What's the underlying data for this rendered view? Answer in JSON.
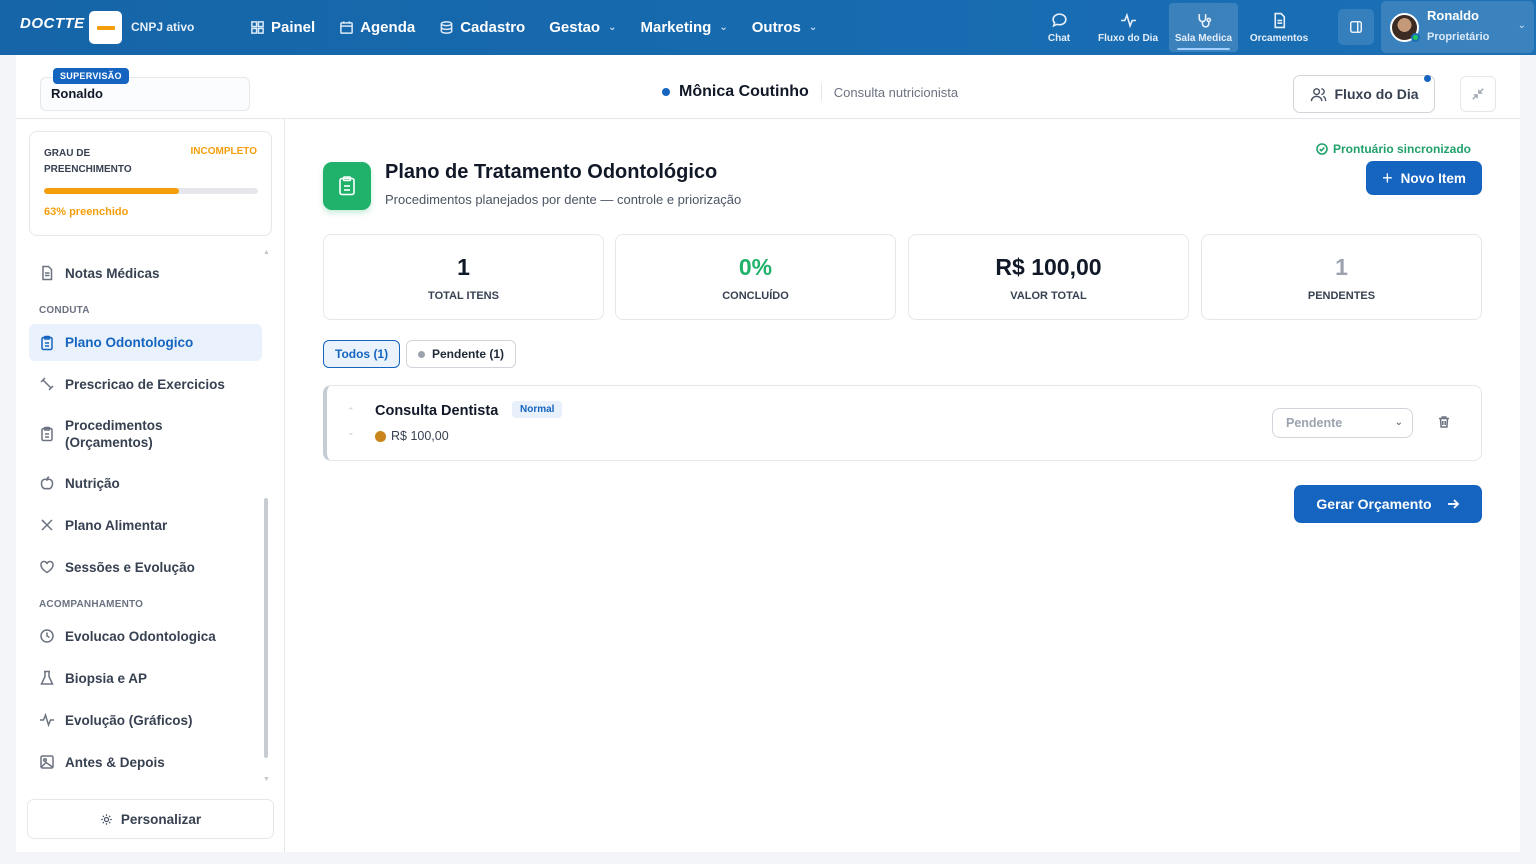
{
  "topbar": {
    "logo": "DOCTTE",
    "cnpj_status": "CNPJ ativo",
    "nav": [
      {
        "label": "Painel"
      },
      {
        "label": "Agenda"
      },
      {
        "label": "Cadastro"
      },
      {
        "label": "Gestao"
      },
      {
        "label": "Marketing"
      },
      {
        "label": "Outros"
      }
    ],
    "quick": [
      {
        "label": "Chat",
        "icon": "chat-icon"
      },
      {
        "label": "Fluxo do Dia",
        "icon": "activity-icon"
      },
      {
        "label": "Sala Medica",
        "icon": "stethoscope-icon"
      },
      {
        "label": "Orcamentos",
        "icon": "document-icon"
      }
    ],
    "user": {
      "name": "Ronaldo",
      "role": "Proprietário"
    }
  },
  "subheader": {
    "supervision_tag": "SUPERVISÃO",
    "supervision_name": "Ronaldo",
    "patient_name": "Mônica Coutinho",
    "consultation": "Consulta nutricionista",
    "fluxo_button": "Fluxo do Dia"
  },
  "sidebar": {
    "progress": {
      "label": "GRAU DE PREENCHIMENTO",
      "status": "INCOMPLETO",
      "percent": 63,
      "text": "63% preenchido"
    },
    "items": [
      {
        "label": "Notas Médicas"
      },
      {
        "label": "Plano Odontologico"
      },
      {
        "label": "Prescricao de Exercicios"
      },
      {
        "label": "Procedimentos (Orçamentos)"
      },
      {
        "label": "Nutrição"
      },
      {
        "label": "Plano Alimentar"
      },
      {
        "label": "Sessões e Evolução"
      },
      {
        "label": "Evolucao Odontologica"
      },
      {
        "label": "Biopsia e AP"
      },
      {
        "label": "Evolução (Gráficos)"
      },
      {
        "label": "Antes & Depois"
      }
    ],
    "sections": {
      "conduta": "CONDUTA",
      "acompanhamento": "ACOMPANHAMENTO"
    },
    "personalizar": "Personalizar"
  },
  "main": {
    "sync_status": "Prontuário sincronizado",
    "title": "Plano de Tratamento Odontológico",
    "subtitle": "Procedimentos planejados por dente — controle e priorização",
    "new_button": "Novo Item",
    "stats": [
      {
        "value": "1",
        "label": "TOTAL ITENS",
        "color": "#111827"
      },
      {
        "value": "0%",
        "label": "CONCLUÍDO",
        "color": "#20b26b"
      },
      {
        "value": "R$ 100,00",
        "label": "VALOR TOTAL",
        "color": "#111827"
      },
      {
        "value": "1",
        "label": "PENDENTES",
        "color": "#9ca3af"
      }
    ],
    "filters": [
      {
        "label": "Todos (1)"
      },
      {
        "label": "Pendente (1)"
      }
    ],
    "items": [
      {
        "name": "Consulta Dentista",
        "priority": "Normal",
        "price": "R$ 100,00",
        "status": "Pendente"
      }
    ],
    "generate_button": "Gerar Orçamento"
  },
  "colors": {
    "primary": "#1565c0",
    "success": "#20b26b",
    "warning": "#f59e0b"
  }
}
